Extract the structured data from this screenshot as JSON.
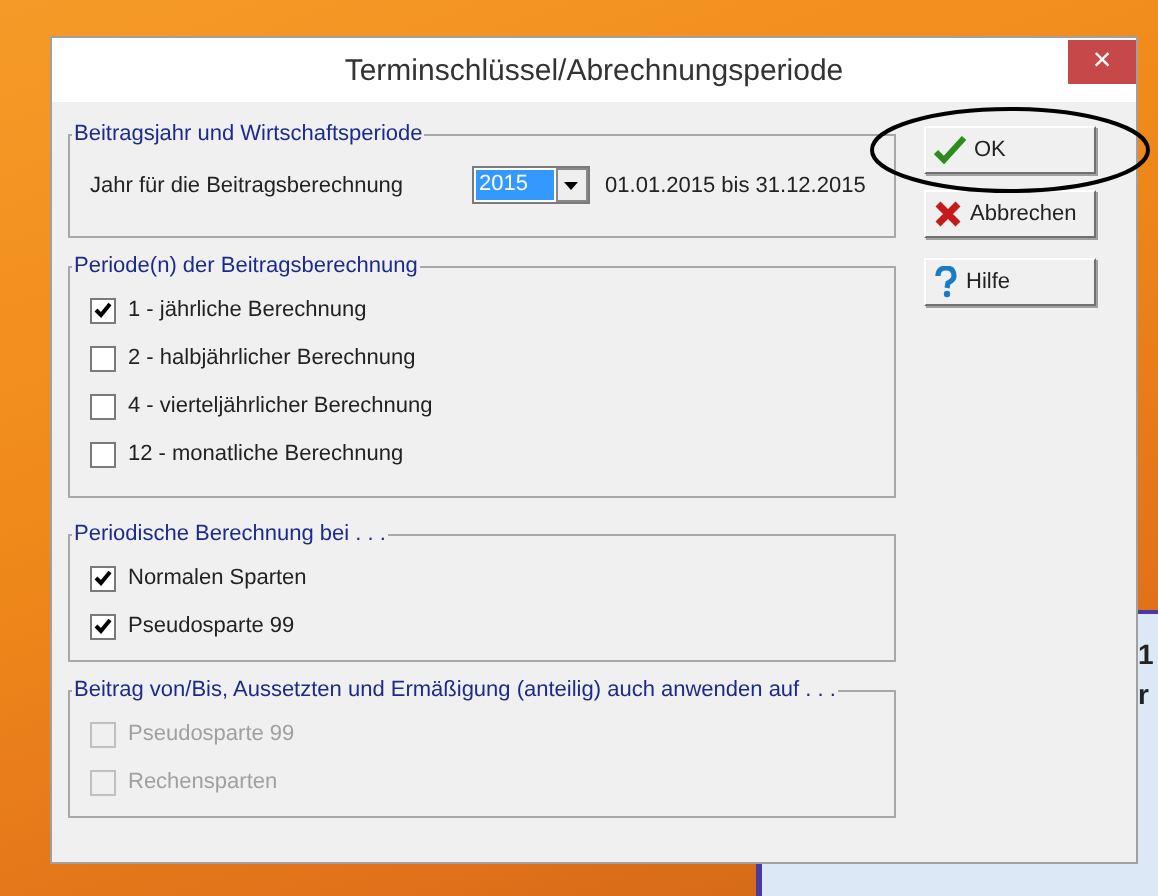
{
  "window": {
    "title": "Terminschlüssel/Abrechnungsperiode",
    "close": "×"
  },
  "year_group": {
    "title": "Beitragsjahr und Wirtschaftsperiode",
    "label": "Jahr für die Beitragsberechnung",
    "value": "2015",
    "range": "01.01.2015 bis 31.12.2015"
  },
  "groups": [
    {
      "title": "Periode(n) der Beitragsberechnung",
      "items": [
        {
          "label": "1 - jährliche Berechnung",
          "checked": true,
          "disabled": false
        },
        {
          "label": "2 - halbjährlicher Berechnung",
          "checked": false,
          "disabled": false
        },
        {
          "label": "4 - vierteljährlicher Berechnung",
          "checked": false,
          "disabled": false
        },
        {
          "label": "12 - monatliche Berechnung",
          "checked": false,
          "disabled": false
        }
      ]
    },
    {
      "title": "Periodische Berechnung bei . . .",
      "items": [
        {
          "label": "Normalen Sparten",
          "checked": true,
          "disabled": false
        },
        {
          "label": "Pseudosparte 99",
          "checked": true,
          "disabled": false
        }
      ]
    },
    {
      "title": "Beitrag von/Bis, Aussetzten und Ermäßigung (anteilig) auch anwenden auf . . .",
      "items": [
        {
          "label": "Pseudosparte 99",
          "checked": false,
          "disabled": true
        },
        {
          "label": "Rechensparten",
          "checked": false,
          "disabled": true
        }
      ]
    }
  ],
  "buttons": [
    {
      "label": "OK",
      "kind": "ok",
      "circled": true
    },
    {
      "label": "Abbrechen",
      "kind": "cancel",
      "circled": false
    },
    {
      "label": "Hilfe",
      "kind": "help",
      "circled": false
    }
  ],
  "background_window": {
    "texts": [
      "1",
      "r"
    ]
  }
}
